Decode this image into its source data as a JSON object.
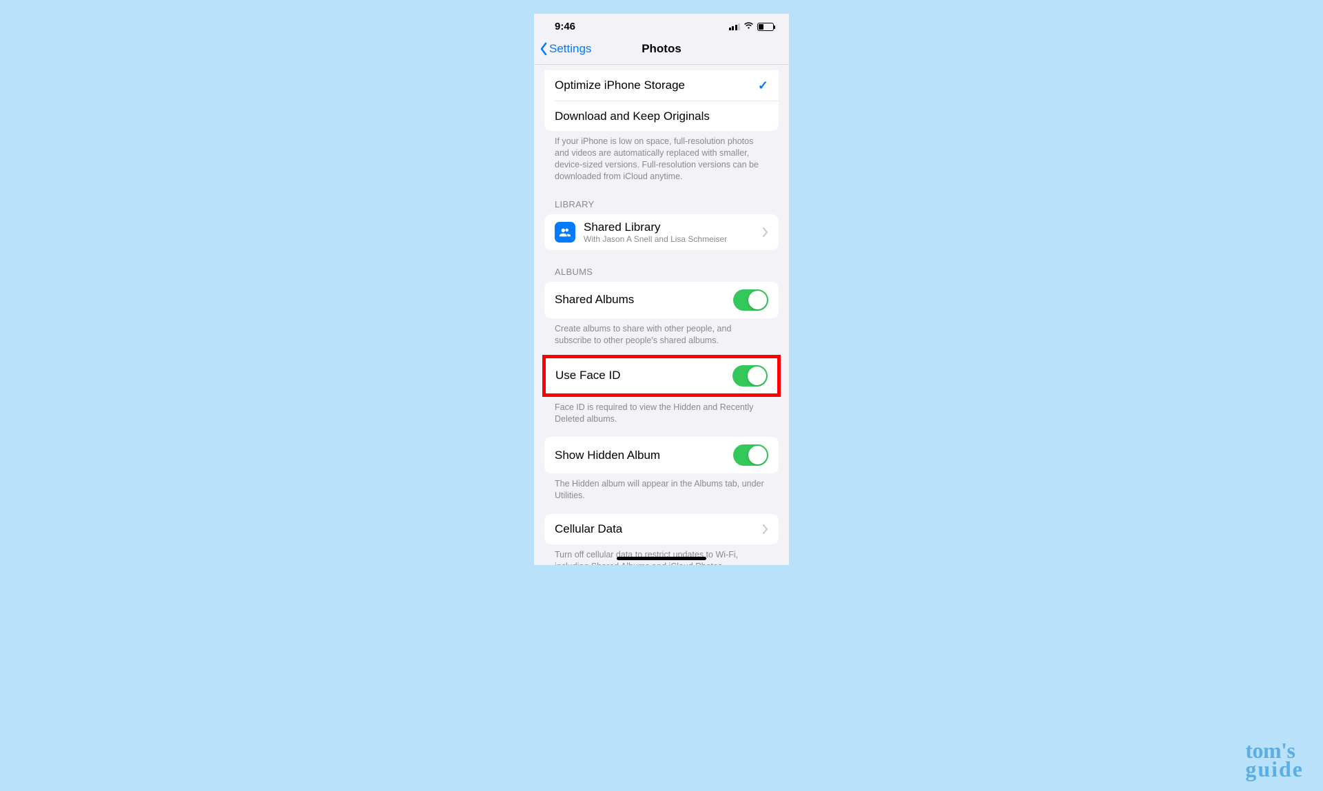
{
  "statusBar": {
    "time": "9:46"
  },
  "nav": {
    "back": "Settings",
    "title": "Photos"
  },
  "storage": {
    "optimize": "Optimize iPhone Storage",
    "download": "Download and Keep Originals",
    "footer": "If your iPhone is low on space, full-resolution photos and videos are automatically replaced with smaller, device-sized versions. Full-resolution versions can be downloaded from iCloud anytime."
  },
  "library": {
    "header": "LIBRARY",
    "title": "Shared Library",
    "subtitle": "With Jason A Snell and Lisa Schmeiser"
  },
  "albums": {
    "header": "ALBUMS",
    "sharedAlbums": "Shared Albums",
    "sharedFooter": "Create albums to share with other people, and subscribe to other people's shared albums.",
    "useFaceID": "Use Face ID",
    "faceIDFooter": "Face ID is required to view the Hidden and Recently Deleted albums.",
    "showHidden": "Show Hidden Album",
    "hiddenFooter": "The Hidden album will appear in the Albums tab, under Utilities."
  },
  "cellular": {
    "title": "Cellular Data",
    "footer": "Turn off cellular data to restrict updates to Wi-Fi, including Shared Albums and iCloud Photos."
  },
  "watermark": {
    "line1": "tom's",
    "line2": "guide"
  }
}
